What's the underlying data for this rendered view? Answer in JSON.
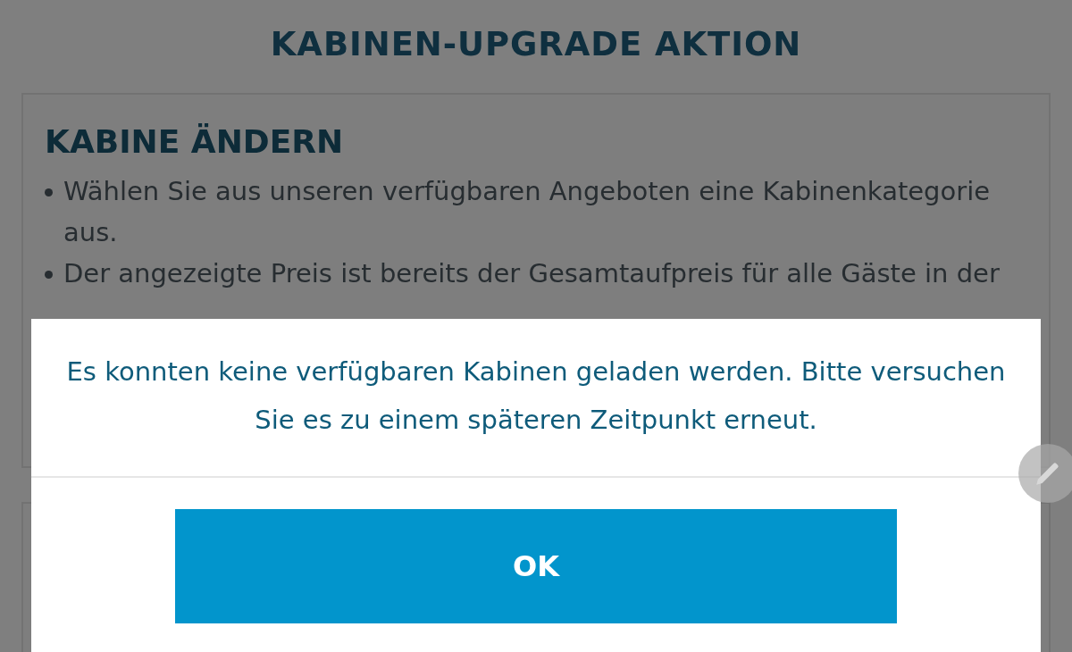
{
  "page": {
    "title": "KABINEN-UPGRADE AKTION",
    "panel": {
      "heading": "KABINE ÄNDERN",
      "bullets": [
        "Wählen Sie aus unseren verfügbaren Angeboten eine Kabinenkategorie aus.",
        "Der angezeigte Preis ist bereits der Gesamtaufpreis für alle Gäste in der"
      ]
    }
  },
  "dialog": {
    "message": "Es konnten keine verfügbaren Kabinen geladen werden. Bitte versuchen Sie es zu einem späteren Zeitpunkt erneut.",
    "button": "OK"
  }
}
